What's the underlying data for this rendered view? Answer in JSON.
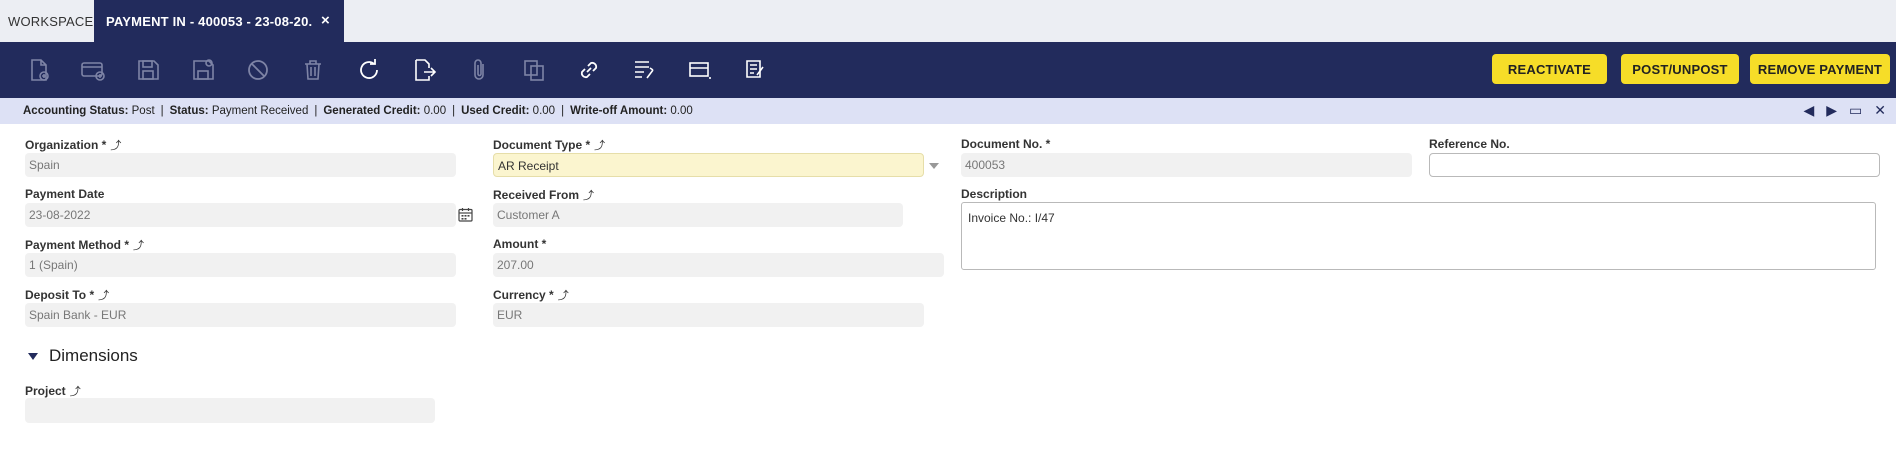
{
  "tabs": {
    "workspace": "WORKSPACE",
    "active": "PAYMENT IN - 400053 - 23-08-20...",
    "close": "×"
  },
  "actions": {
    "reactivate": "REACTIVATE",
    "post_unpost": "POST/UNPOST",
    "remove_payment": "REMOVE PAYMENT"
  },
  "status": {
    "accounting_label": "Accounting Status:",
    "accounting_value": "Post",
    "status_label": "Status:",
    "status_value": "Payment Received",
    "generated_label": "Generated Credit:",
    "generated_value": "0.00",
    "used_label": "Used Credit:",
    "used_value": "0.00",
    "writeoff_label": "Write-off Amount:",
    "writeoff_value": "0.00"
  },
  "form": {
    "organization": {
      "label": "Organization *",
      "value": "Spain"
    },
    "document_type": {
      "label": "Document Type *",
      "value": "AR Receipt"
    },
    "document_no": {
      "label": "Document No. *",
      "value": "400053"
    },
    "reference_no": {
      "label": "Reference No.",
      "value": ""
    },
    "payment_date": {
      "label": "Payment Date",
      "value": "23-08-2022"
    },
    "received_from": {
      "label": "Received From",
      "value": "Customer A"
    },
    "description": {
      "label": "Description",
      "value": "Invoice No.: I/47"
    },
    "payment_method": {
      "label": "Payment Method *",
      "value": "1 (Spain)"
    },
    "amount": {
      "label": "Amount *",
      "value": "207.00"
    },
    "deposit_to": {
      "label": "Deposit To *",
      "value": "Spain Bank - EUR"
    },
    "currency": {
      "label": "Currency *",
      "value": "EUR"
    }
  },
  "dimensions": {
    "title": "Dimensions",
    "project": {
      "label": "Project",
      "value": ""
    }
  },
  "colors": {
    "header_bg": "#222b5c",
    "accent_yellow": "#f6dd28",
    "status_bg": "#dde1f5",
    "highlight_field": "#fbf5cf"
  }
}
